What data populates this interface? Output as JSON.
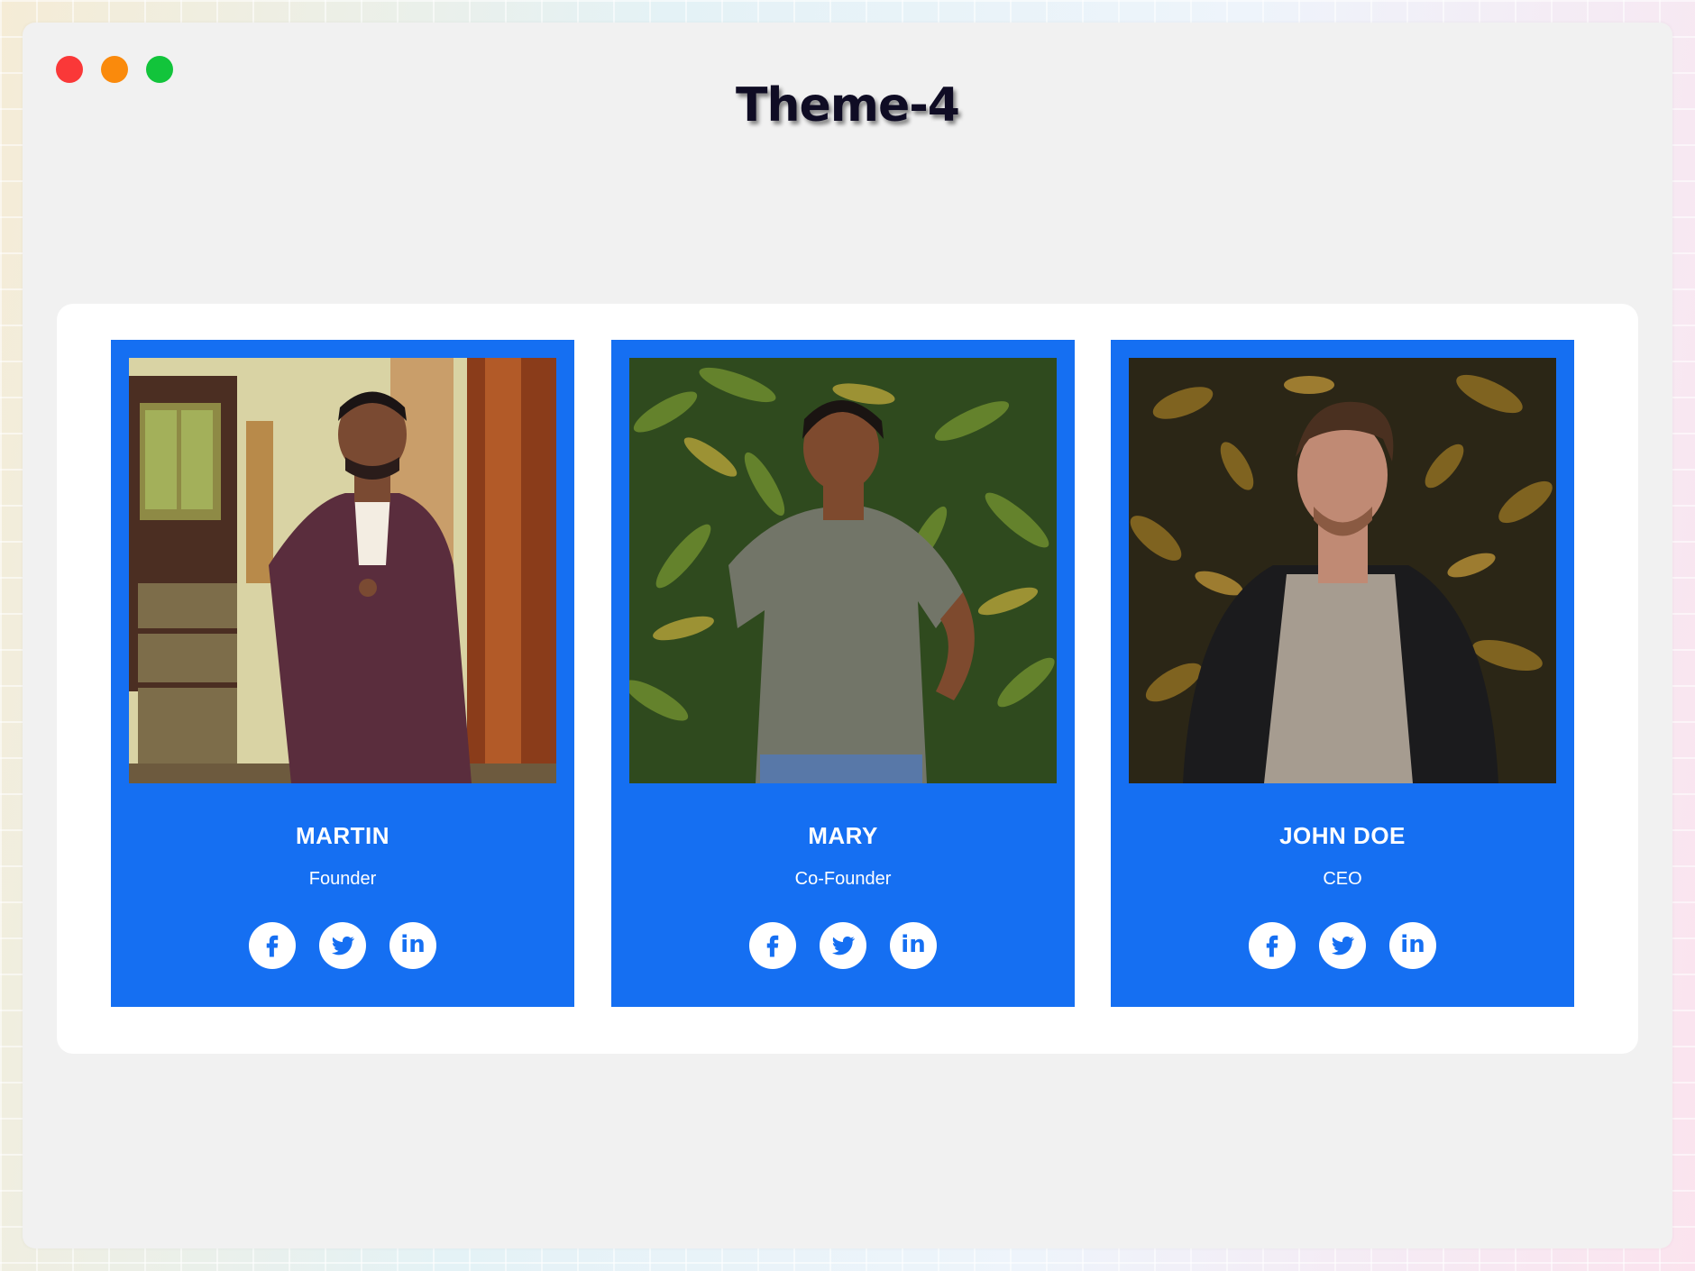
{
  "window": {
    "title": "Theme-4",
    "title_color": "#0f0c24",
    "traffic_lights": [
      {
        "name": "close",
        "color": "#fa3838"
      },
      {
        "name": "minimize",
        "color": "#fa8a0c"
      },
      {
        "name": "maximize",
        "color": "#12c43b"
      }
    ]
  },
  "theme": {
    "card_color": "#156ff2",
    "panel_color": "#ffffff",
    "window_bg": "#f1f1f1"
  },
  "team": [
    {
      "name": "MARTIN",
      "role": "Founder",
      "photo_icon": "portrait-man-in-suit",
      "socials": [
        "facebook-icon",
        "twitter-icon",
        "linkedin-icon"
      ]
    },
    {
      "name": "MARY",
      "role": "Co-Founder",
      "photo_icon": "portrait-boy-in-leaves",
      "socials": [
        "facebook-icon",
        "twitter-icon",
        "linkedin-icon"
      ]
    },
    {
      "name": "JOHN DOE",
      "role": "CEO",
      "photo_icon": "portrait-man-in-leather-jacket",
      "socials": [
        "facebook-icon",
        "twitter-icon",
        "linkedin-icon"
      ]
    }
  ],
  "social_labels": {
    "linkedin": "in"
  }
}
